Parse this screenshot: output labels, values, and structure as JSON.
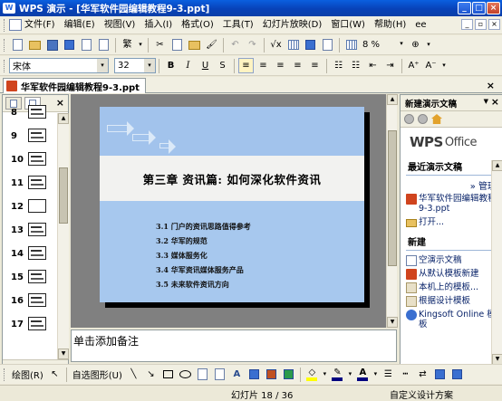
{
  "window": {
    "app_label": "WPS 演示",
    "title": "WPS 演示 - [华军软件园编辑教程9-3.ppt]",
    "controls": [
      "_",
      "□",
      "×"
    ]
  },
  "menu": {
    "items": [
      "文件(F)",
      "编辑(E)",
      "视图(V)",
      "插入(I)",
      "格式(O)",
      "工具(T)",
      "幻灯片放映(D)",
      "窗口(W)",
      "帮助(H)",
      "ee"
    ]
  },
  "toolbar": {
    "zoom": "8 %",
    "traditional": "繁"
  },
  "format_toolbar": {
    "font_name": "宋体",
    "font_size": "32",
    "bold": "B",
    "italic": "I",
    "underline": "U",
    "strike": "S",
    "grow": "A⁺",
    "shrink": "A⁻"
  },
  "document_tab": {
    "filename": "华军软件园编辑教程9-3.ppt"
  },
  "slides_panel": {
    "numbers": [
      "8",
      "9",
      "10",
      "11",
      "12",
      "13",
      "14",
      "15",
      "16",
      "17"
    ]
  },
  "slide": {
    "title": "第三章  资讯篇:  如何深化软件资讯",
    "bullets": [
      "3.1  门户的资讯思路值得参考",
      "3.2  华军的规范",
      "3.3  媒体服务化",
      "3.4  华军资讯媒体服务产品",
      "3.5   未来软件资讯方向"
    ]
  },
  "notes": {
    "placeholder": "单击添加备注"
  },
  "drawing_toolbar": {
    "draw_label": "绘图(R)",
    "autoshape_label": "自选图形(U)"
  },
  "status": {
    "slide_info": "幻灯片 18 / 36",
    "design": "自定义设计方案"
  },
  "task_pane": {
    "title": "新建演示文稿",
    "logo_main": "WPS",
    "logo_sub": "Office",
    "recent_heading": "最近演示文稿",
    "manage": "» 管理",
    "recent_file": "华军软件园编辑教程9-3.ppt",
    "open": "打开...",
    "new_heading": "新建",
    "new_items": [
      "空演示文稿",
      "从默认模板新建",
      "本机上的模板...",
      "根据设计模板",
      "Kingsoft Online 模板"
    ]
  },
  "colors": {
    "title_bar": "#0A5FE0",
    "slide_bg": "#A7C8EE",
    "band": "#F2F2F0",
    "canvas": "#808080"
  }
}
